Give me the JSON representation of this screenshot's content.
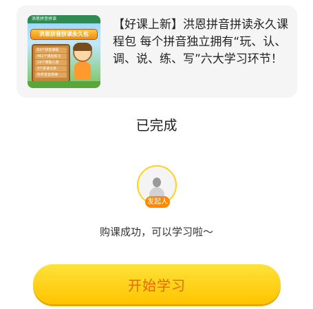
{
  "course": {
    "description": "【好课上新】洪恩拼音拼读永久课程包 每个拼音独立拥有“玩、认、调、说、练、写”六大学习环节！",
    "thumbnail": {
      "header": "洪恩拼音拼读",
      "title": "洪恩拼音拼读永久包",
      "lines": [
        "63个拼音课程",
        "461个课后练习",
        "19个课程小游",
        "3个拼读大表",
        "科学发音规律"
      ]
    }
  },
  "status": {
    "title": "已完成",
    "initiator_badge": "发起人",
    "message": "购课成功，可以学习啦～"
  },
  "actions": {
    "start_label": "开始学习"
  },
  "colors": {
    "accent": "#ffc400",
    "badge": "#ff8a00",
    "button_text": "#e46a00",
    "card_bg": "#f5f5f5"
  }
}
